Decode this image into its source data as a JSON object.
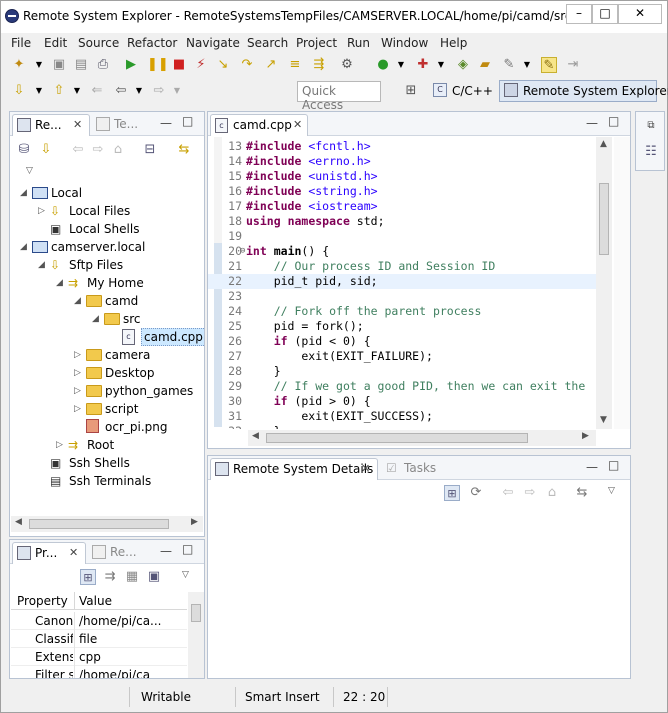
{
  "window": {
    "title": "Remote System Explorer - RemoteSystemsTempFiles/CAMSERVER.LOCAL/home/pi/camd/src/camd...",
    "buttons": {
      "minimize": "–",
      "maximize": "□",
      "close": "✕"
    }
  },
  "menu": [
    "File",
    "Edit",
    "Source",
    "Refactor",
    "Navigate",
    "Search",
    "Project",
    "Run",
    "Window",
    "Help"
  ],
  "toolbar": {
    "quick_access_placeholder": "Quick Access",
    "perspectives": [
      {
        "label": "C/C++",
        "active": false
      },
      {
        "label": "Remote System Explorer",
        "active": true
      }
    ]
  },
  "remote_systems_view": {
    "tabs": [
      "Re...",
      "Te..."
    ],
    "tree": [
      {
        "label": "Local",
        "depth": 0,
        "expanded": true,
        "icon": "computer-icon"
      },
      {
        "label": "Local Files",
        "depth": 1,
        "expanded": false,
        "icon": "files-icon"
      },
      {
        "label": "Local Shells",
        "depth": 1,
        "expanded": null,
        "icon": "shell-icon"
      },
      {
        "label": "camserver.local",
        "depth": 0,
        "expanded": true,
        "icon": "remote-computer-icon"
      },
      {
        "label": "Sftp Files",
        "depth": 1,
        "expanded": true,
        "icon": "files-icon"
      },
      {
        "label": "My Home",
        "depth": 2,
        "expanded": true,
        "icon": "home-filter-icon"
      },
      {
        "label": "camd",
        "depth": 3,
        "expanded": true,
        "icon": "folder-open-icon"
      },
      {
        "label": "src",
        "depth": 4,
        "expanded": true,
        "icon": "folder-open-icon"
      },
      {
        "label": "camd.cpp",
        "depth": 5,
        "expanded": null,
        "icon": "cpp-file-icon",
        "selected": true
      },
      {
        "label": "camera",
        "depth": 3,
        "expanded": false,
        "icon": "folder-icon"
      },
      {
        "label": "Desktop",
        "depth": 3,
        "expanded": false,
        "icon": "folder-icon"
      },
      {
        "label": "python_games",
        "depth": 3,
        "expanded": false,
        "icon": "folder-icon"
      },
      {
        "label": "script",
        "depth": 3,
        "expanded": false,
        "icon": "folder-icon"
      },
      {
        "label": "ocr_pi.png",
        "depth": 3,
        "expanded": null,
        "icon": "image-file-icon"
      },
      {
        "label": "Root",
        "depth": 2,
        "expanded": false,
        "icon": "root-filter-icon"
      },
      {
        "label": "Ssh Shells",
        "depth": 1,
        "expanded": null,
        "icon": "shell-icon"
      },
      {
        "label": "Ssh Terminals",
        "depth": 1,
        "expanded": null,
        "icon": "terminal-icon"
      }
    ]
  },
  "properties_view": {
    "tabs": [
      "Pr...",
      "Re..."
    ],
    "headers": [
      "Property",
      "Value"
    ],
    "rows": [
      [
        "Canoni",
        "/home/pi/ca..."
      ],
      [
        "Classifi",
        "file"
      ],
      [
        "Extensi",
        "cpp"
      ],
      [
        "Filter st",
        "/home/pi/ca"
      ]
    ]
  },
  "editor": {
    "tab": "camd.cpp",
    "lines": [
      {
        "n": "13",
        "t": "#include <fcntl.h>"
      },
      {
        "n": "14",
        "t": "#include <errno.h>"
      },
      {
        "n": "15",
        "t": "#include <unistd.h>"
      },
      {
        "n": "16",
        "t": "#include <string.h>"
      },
      {
        "n": "17",
        "t": "#include <iostream>"
      },
      {
        "n": "18",
        "t": "using namespace std;"
      },
      {
        "n": "19",
        "t": ""
      },
      {
        "n": "20",
        "t": "int main() {"
      },
      {
        "n": "21",
        "t": "    // Our process ID and Session ID"
      },
      {
        "n": "22",
        "t": "    pid_t pid, sid;"
      },
      {
        "n": "23",
        "t": ""
      },
      {
        "n": "24",
        "t": "    // Fork off the parent process"
      },
      {
        "n": "25",
        "t": "    pid = fork();"
      },
      {
        "n": "26",
        "t": "    if (pid < 0) {"
      },
      {
        "n": "27",
        "t": "        exit(EXIT_FAILURE);"
      },
      {
        "n": "28",
        "t": "    }"
      },
      {
        "n": "29",
        "t": "    // If we got a good PID, then we can exit the"
      },
      {
        "n": "30",
        "t": "    if (pid > 0) {"
      },
      {
        "n": "31",
        "t": "        exit(EXIT_SUCCESS);"
      },
      {
        "n": "32",
        "t": "    }"
      }
    ]
  },
  "details_view": {
    "tabs": [
      "Remote System Details",
      "Tasks"
    ]
  },
  "status": {
    "mode": "Writable",
    "insert": "Smart Insert",
    "position": "22 : 20"
  },
  "colors": {
    "keyword": "#7f0055",
    "string": "#2a00ff",
    "comment": "#3f7f5f",
    "selection": "#cce8ff",
    "active_perspective": "#dfe8f4"
  }
}
